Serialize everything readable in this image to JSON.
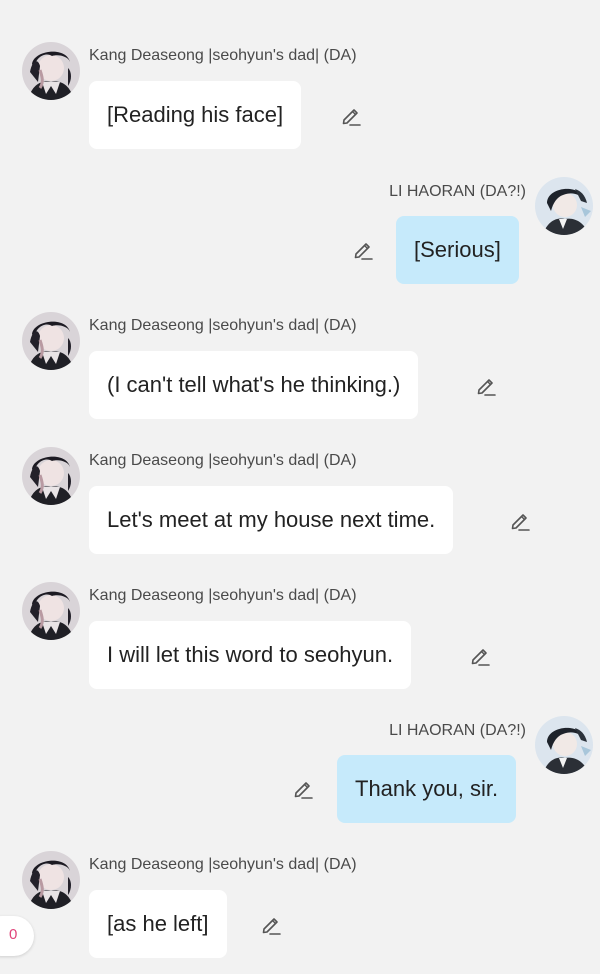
{
  "badge": {
    "count": "0"
  },
  "messages": [
    {
      "sender": "Kang Deaseong |seohyun's dad| (DA)",
      "text": "[Reading his face]"
    },
    {
      "sender": "LI HAORAN (DA?!)",
      "text": "[Serious]"
    },
    {
      "sender": "Kang Deaseong |seohyun's dad| (DA)",
      "text": "(I can't tell what's he thinking.)"
    },
    {
      "sender": "Kang Deaseong |seohyun's dad| (DA)",
      "text": "Let's meet at my house next time."
    },
    {
      "sender": "Kang Deaseong |seohyun's dad| (DA)",
      "text": "I will let this word to seohyun."
    },
    {
      "sender": "LI HAORAN (DA?!)",
      "text": "Thank you, sir."
    },
    {
      "sender": "Kang Deaseong |seohyun's dad| (DA)",
      "text": "[as he left]"
    }
  ],
  "icons": {
    "avatar_left": "character-avatar",
    "avatar_right": "character-avatar",
    "edit": "pencil-icon"
  },
  "colors": {
    "background": "#f2f2f2",
    "bubble_left": "#ffffff",
    "bubble_right": "#c6eafb",
    "badge_text": "#e0457b"
  }
}
